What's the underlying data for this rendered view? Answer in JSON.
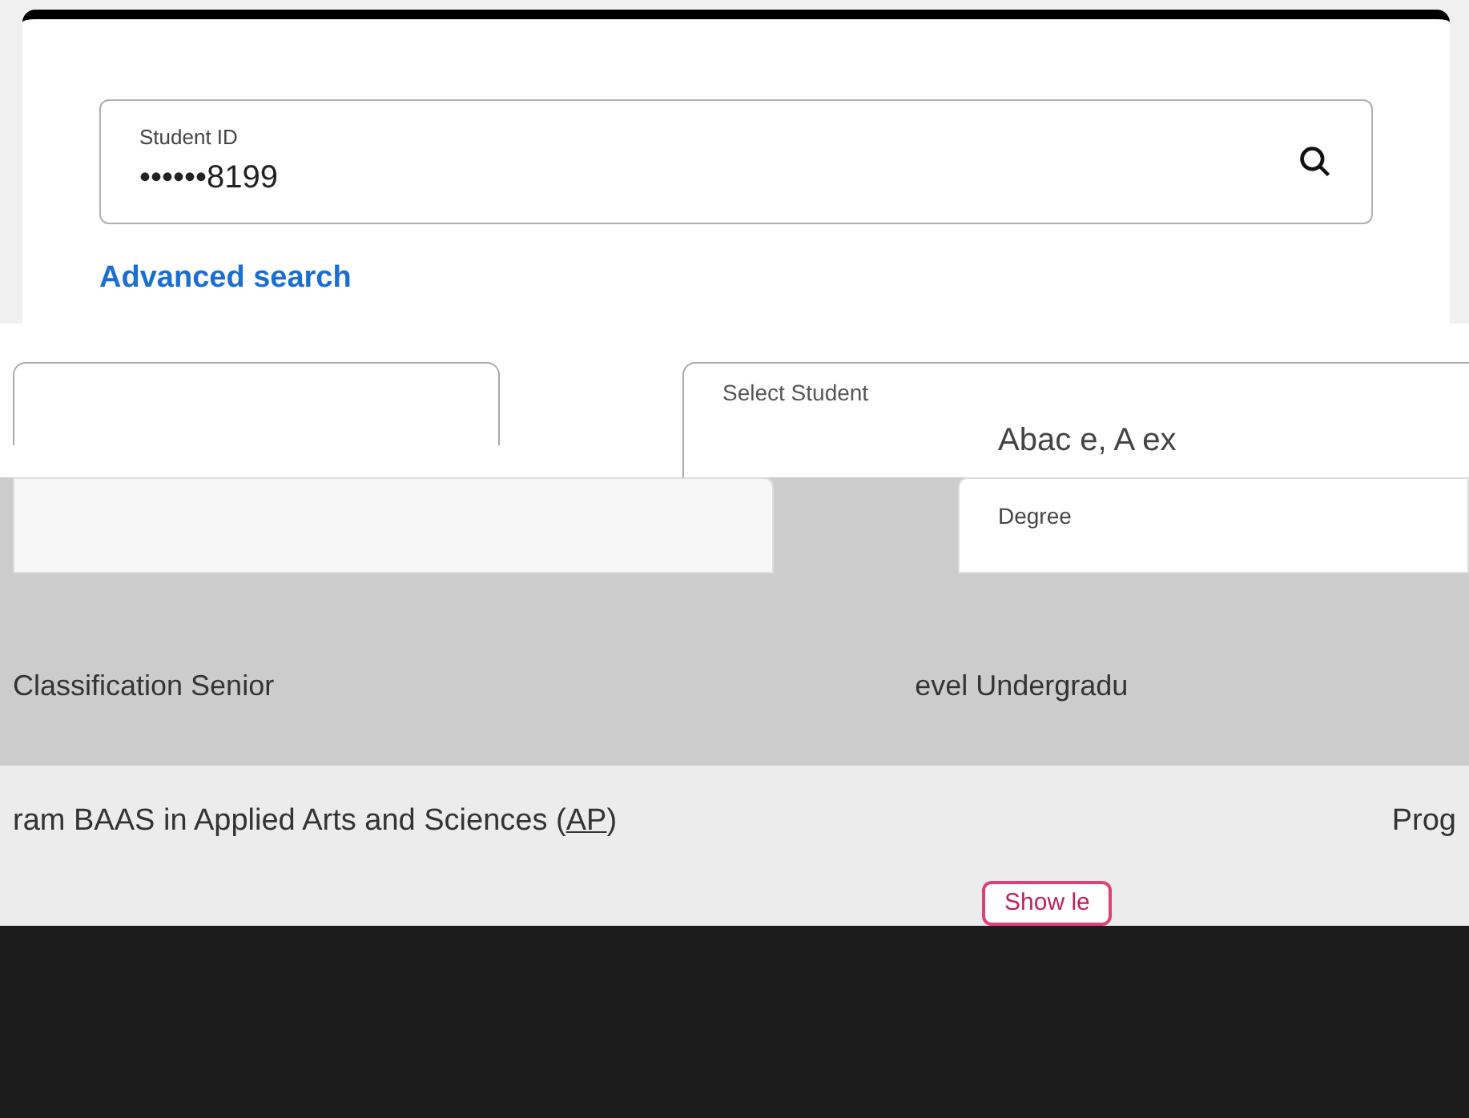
{
  "search": {
    "label": "Student ID",
    "value": "••••••8199"
  },
  "advanced_link": "Advanced search",
  "select_student": {
    "label": "Select Student",
    "value": "Abac e, A ex"
  },
  "degree": {
    "label": "Degree"
  },
  "details": [
    {
      "text": "Classification Senior"
    },
    {
      "text": "evel Undergradu"
    }
  ],
  "program": {
    "text": "ram BAAS in Applied Arts and Sciences (",
    "code": "AP",
    "close": ")",
    "right": "Prog"
  },
  "toggle_button": "Show le"
}
